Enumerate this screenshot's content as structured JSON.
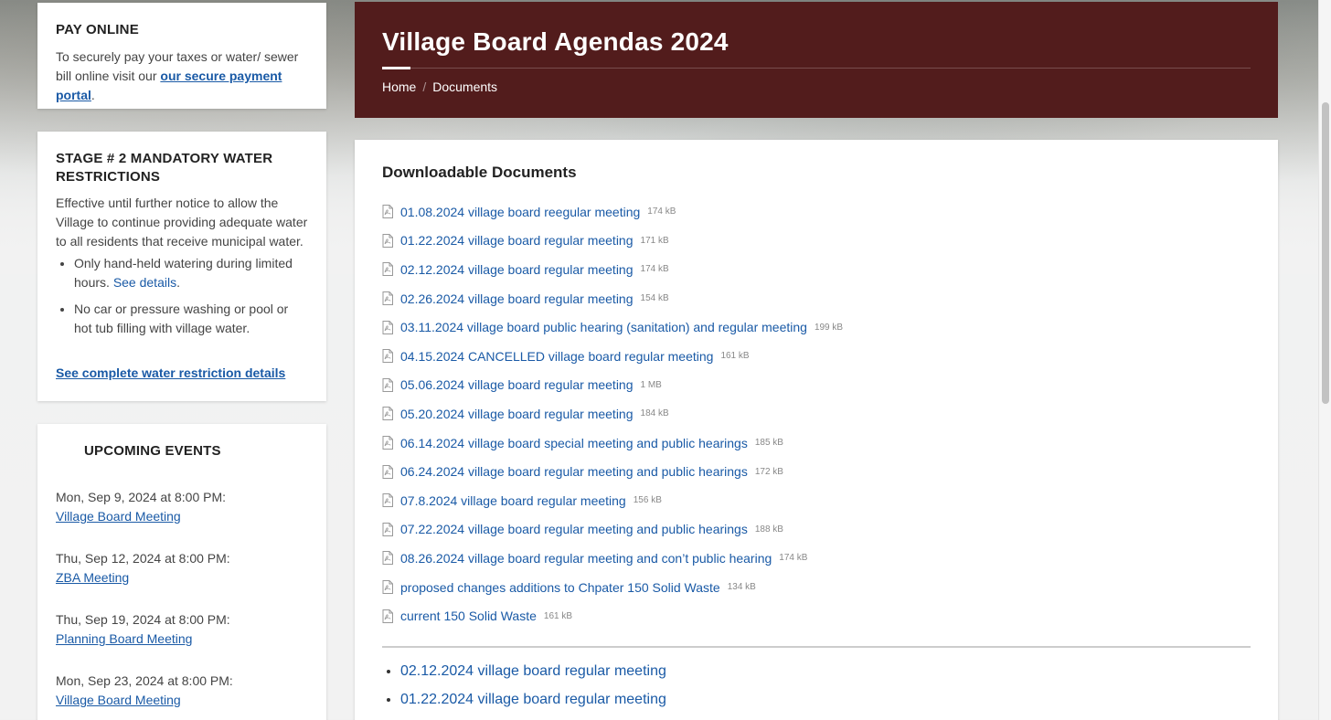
{
  "pay_online": {
    "title": "PAY ONLINE",
    "text_before": "To securely pay your taxes or water/ sewer bill online visit our ",
    "link": "our secure payment portal",
    "text_after": "."
  },
  "water": {
    "title": "STAGE # 2 MANDATORY WATER RESTRICTIONS",
    "intro": "Effective until further notice to allow the Village to continue providing adequate water to all residents that receive municipal water.",
    "bullet1_text": "Only hand-held watering during limited hours. ",
    "bullet1_link": "See details",
    "bullet1_end": ".",
    "bullet2_text": "No car or pressure washing or pool or hot tub filling with village water.",
    "more_link": "See complete water restriction details"
  },
  "events": {
    "title": "UPCOMING EVENTS",
    "items": [
      {
        "date": "Mon, Sep 9, 2024 at 8:00 PM:",
        "name": "Village Board Meeting"
      },
      {
        "date": "Thu, Sep 12, 2024 at 8:00 PM:",
        "name": "ZBA Meeting"
      },
      {
        "date": "Thu, Sep 19, 2024 at 8:00 PM:",
        "name": "Planning Board Meeting"
      },
      {
        "date": "Mon, Sep 23, 2024 at 8:00 PM:",
        "name": "Village Board Meeting"
      }
    ]
  },
  "hero": {
    "title": "Village Board Agendas 2024",
    "crumb_home": "Home",
    "crumb_sep": "/",
    "crumb_current": "Documents"
  },
  "documents": {
    "heading": "Downloadable Documents",
    "files": [
      {
        "name": "01.08.2024 village board reegular meeting",
        "size": "174 kB"
      },
      {
        "name": "01.22.2024 village board regular meeting",
        "size": "171 kB"
      },
      {
        "name": "02.12.2024 village board regular meeting",
        "size": "174 kB"
      },
      {
        "name": "02.26.2024 village board regular meeting",
        "size": "154 kB"
      },
      {
        "name": "03.11.2024 village board public hearing (sanitation) and regular meeting",
        "size": "199 kB"
      },
      {
        "name": "04.15.2024 CANCELLED village board regular meeting",
        "size": "161 kB"
      },
      {
        "name": "05.06.2024 village board regular meeting",
        "size": "1 MB"
      },
      {
        "name": "05.20.2024 village board regular meeting",
        "size": "184 kB"
      },
      {
        "name": "06.14.2024 village board special meeting and public hearings",
        "size": "185 kB"
      },
      {
        "name": "06.24.2024 village board regular meeting and public hearings",
        "size": "172 kB"
      },
      {
        "name": "07.8.2024 village board regular meeting",
        "size": "156 kB"
      },
      {
        "name": "07.22.2024 village board regular meeting and public hearings",
        "size": "188 kB"
      },
      {
        "name": "08.26.2024 village board regular meeting and con’t public hearing",
        "size": "174 kB"
      },
      {
        "name": "proposed changes additions to Chpater 150 Solid Waste",
        "size": "134 kB"
      },
      {
        "name": "current 150 Solid Waste",
        "size": "161 kB"
      }
    ],
    "extra_links": [
      "02.12.2024 village board regular meeting",
      "01.22.2024 village board regular meeting"
    ]
  },
  "icons": {
    "file": "pdf-file-icon"
  }
}
